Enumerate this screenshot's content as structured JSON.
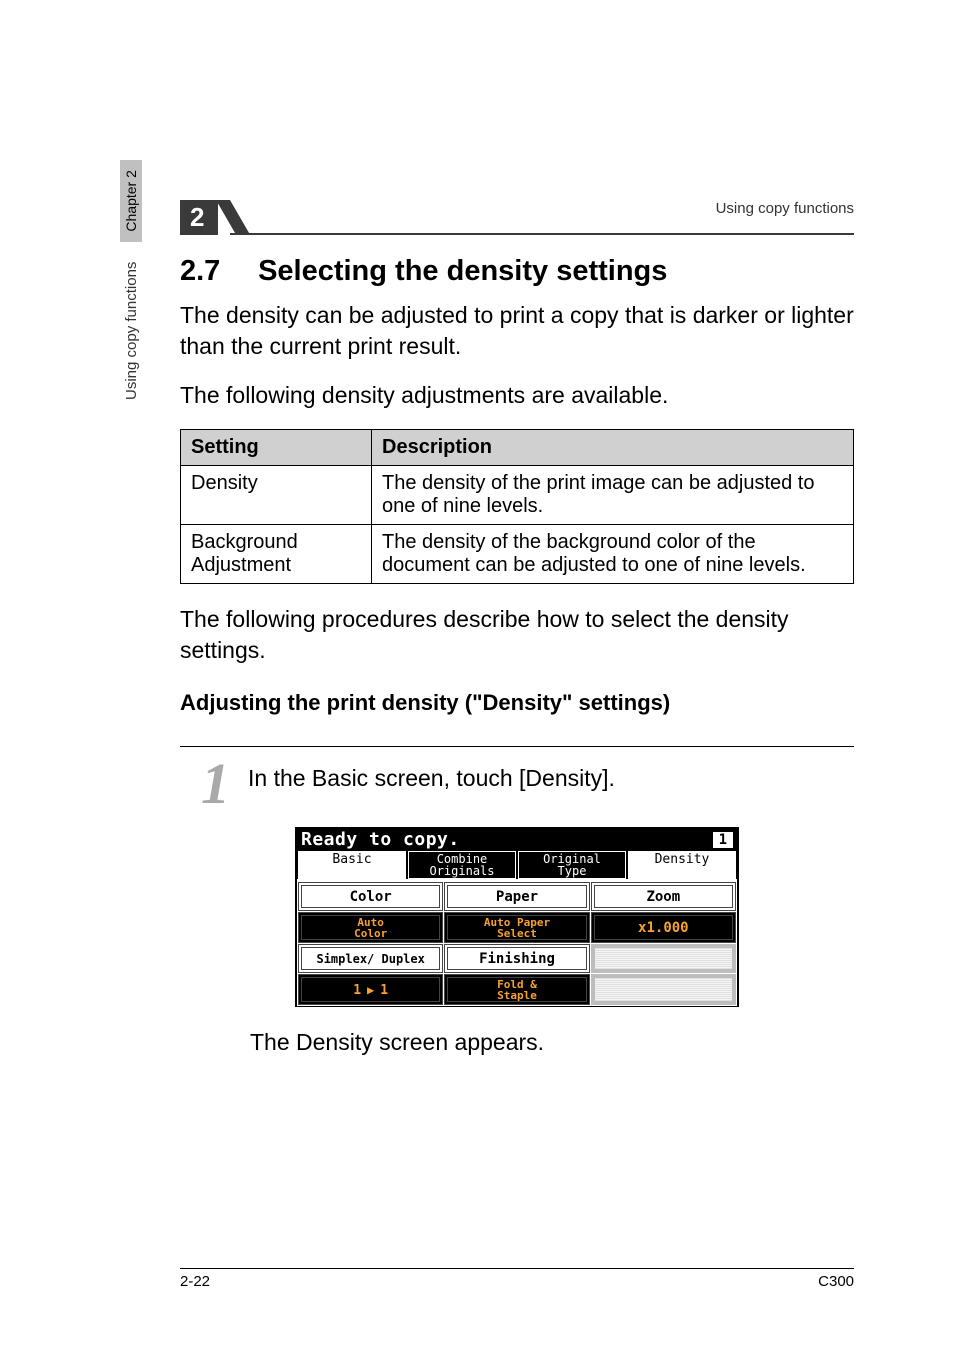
{
  "running_header": "Using copy functions",
  "chapter_tab": "2",
  "side": {
    "chapter": "Chapter 2",
    "title": "Using copy functions"
  },
  "section": {
    "number": "2.7",
    "title": "Selecting the density settings"
  },
  "para1": "The density can be adjusted to print a copy that is darker or lighter than the current print result.",
  "para2": "The following density adjustments are available.",
  "table": {
    "head": {
      "setting": "Setting",
      "description": "Description"
    },
    "rows": [
      {
        "setting": "Density",
        "description": "The density of the print image can be adjusted to one of nine levels."
      },
      {
        "setting": "Background Adjustment",
        "description": "The density of the background color of the document can be adjusted to one of nine levels."
      }
    ]
  },
  "para3": "The following procedures describe how to select the density settings.",
  "subhead": "Adjusting the print density (\"Density\" settings)",
  "step1": {
    "num": "1",
    "text": "In the Basic screen, touch [Density]."
  },
  "lcd": {
    "title": "Ready to copy.",
    "corner": "1",
    "tabs": {
      "basic": "Basic",
      "combine": "Combine\nOriginals",
      "original": "Original\nType",
      "density": "Density"
    },
    "cells": {
      "color": "Color",
      "paper": "Paper",
      "zoom": "Zoom",
      "auto_color": "Auto\nColor",
      "auto_paper": "Auto Paper\nSelect",
      "x1": "x1.000",
      "simplex": "Simplex/\nDuplex",
      "finishing": "Finishing",
      "one_a": "1",
      "one_b": "1",
      "fold": "Fold &\nStaple"
    }
  },
  "after_lcd": "The Density screen appears.",
  "footer": {
    "left": "2-22",
    "right": "C300"
  }
}
